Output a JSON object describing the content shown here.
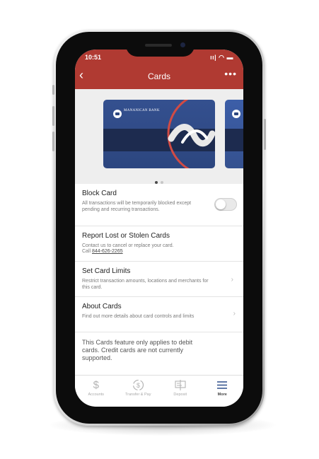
{
  "status_bar": {
    "time": "10:51",
    "icons": "ıı|  ◠ ▬"
  },
  "nav": {
    "title": "Cards",
    "back_icon": "chevron-left-icon",
    "more_icon": "ellipsis-icon"
  },
  "card": {
    "bank_name": "MANANICAN BANK"
  },
  "carousel": {
    "pages": 2,
    "active_page": 1
  },
  "settings": {
    "block_card": {
      "title": "Block Card",
      "description": "All transactions will be temporarily blocked except pending and recurring transactions.",
      "enabled": false
    },
    "report_lost": {
      "title": "Report Lost or Stolen Cards",
      "description": "Contact us to cancel or replace your card.",
      "call_prefix": "Call",
      "phone": "844-626-2265"
    },
    "card_limits": {
      "title": "Set Card Limits",
      "description": "Restrict transaction amounts, locations and merchants for this card."
    },
    "about_cards": {
      "title": "About Cards",
      "description": "Find out more details about card controls and limits"
    },
    "note": "This Cards feature only applies to debit cards. Credit cards are not currently supported."
  },
  "tabbar": {
    "tabs": [
      {
        "label": "Accounts",
        "icon": "dollar-icon",
        "active": false
      },
      {
        "label": "Transfer & Pay",
        "icon": "transfer-icon",
        "active": false
      },
      {
        "label": "Deposit",
        "icon": "deposit-icon",
        "active": false
      },
      {
        "label": "More",
        "icon": "menu-icon",
        "active": true
      }
    ]
  },
  "colors": {
    "brand": "#b03a32",
    "card_blue": "#2c467f",
    "card_ring": "#d14b44"
  }
}
